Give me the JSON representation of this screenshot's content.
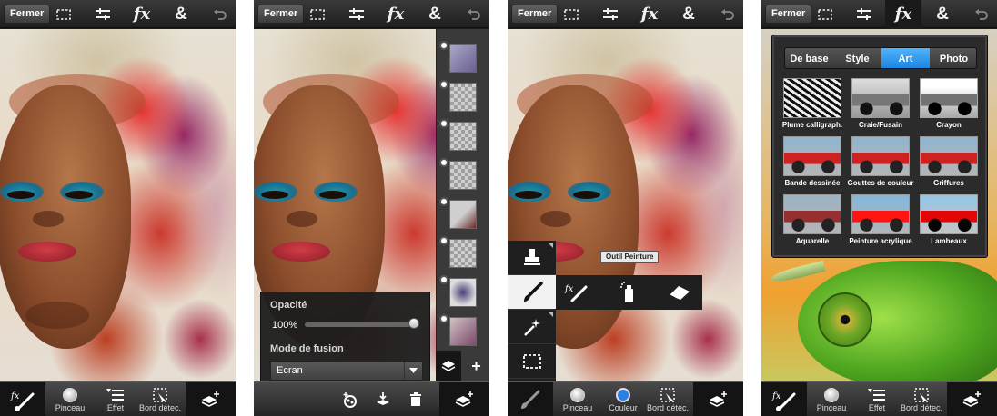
{
  "topbar": {
    "close_label": "Fermer",
    "amp_label": "&",
    "fx_label": "fx"
  },
  "bottombar": {
    "brush": "Pinceau",
    "effect": "Effet",
    "edge": "Bord détec.",
    "color": "Couleur",
    "fx_label": "fx"
  },
  "layers_panel": {
    "opacity_label": "Opacité",
    "opacity_value": "100%",
    "opacity_level": 1.0,
    "blend_label": "Mode de fusion",
    "blend_value": "Ecran"
  },
  "tools": {
    "tooltip": "Outil Peinture",
    "color_hex": "#2a7fe0"
  },
  "effects": {
    "tabs": [
      {
        "label": "De base",
        "active": false
      },
      {
        "label": "Style",
        "active": false
      },
      {
        "label": "Art",
        "active": true
      },
      {
        "label": "Photo",
        "active": false
      }
    ],
    "filters": [
      "Plume calligraph.",
      "Craie/Fusain",
      "Crayon",
      "Bande dessinée",
      "Gouttes de couleur",
      "Griffures",
      "Aquarelle",
      "Peinture acrylique",
      "Lambeaux"
    ],
    "accent": "#1b7fd9"
  }
}
